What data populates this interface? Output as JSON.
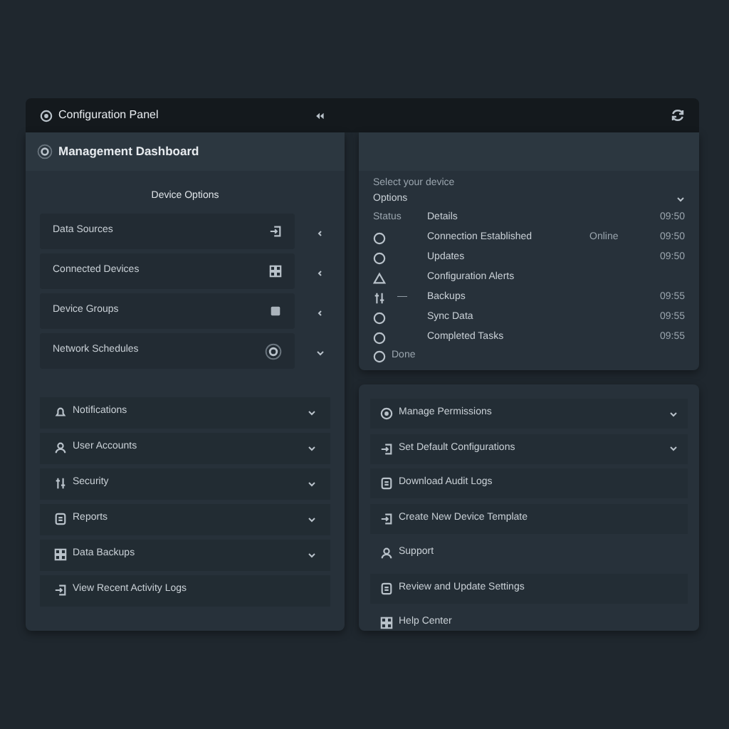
{
  "top_bar": {
    "title": "Configuration Panel"
  },
  "left_panel": {
    "title": "Management Dashboard",
    "subtitle": "Device Options",
    "settings": [
      {
        "label": "Data Sources",
        "expanded": false
      },
      {
        "label": "Connected Devices",
        "expanded": false
      },
      {
        "label": "Device Groups",
        "expanded": false
      },
      {
        "label": "Network Schedules",
        "expanded": true
      }
    ],
    "sections": [
      {
        "label": "Notifications",
        "kind": "collapsible"
      },
      {
        "label": "User Accounts",
        "kind": "collapsible"
      },
      {
        "label": "Security",
        "kind": "collapsible"
      },
      {
        "label": "Reports",
        "kind": "collapsible"
      },
      {
        "label": "Data Backups",
        "kind": "collapsible"
      },
      {
        "label": "View Recent Activity Logs",
        "kind": "link"
      }
    ]
  },
  "status_panel": {
    "caption": "Select your device",
    "filter": "Options",
    "columns": [
      "Status",
      "Details",
      "09:50"
    ],
    "rows": [
      {
        "name": "Connection Established",
        "note": "Online",
        "time": "09:50"
      },
      {
        "name": "Updates",
        "time": "09:50"
      },
      {
        "name": "Configuration Alerts"
      },
      {
        "marker": "—",
        "name": "Backups",
        "time": "09:55"
      },
      {
        "name": "Sync Data",
        "time": "09:55"
      },
      {
        "name": "Completed Tasks",
        "time": "09:55"
      }
    ],
    "footer": "Done"
  },
  "actions_panel": {
    "items": [
      {
        "label": "Manage Permissions",
        "kind": "collapsible"
      },
      {
        "label": "Set Default Configurations",
        "kind": "collapsible"
      },
      {
        "label": "Download Audit Logs",
        "kind": "link"
      },
      {
        "label": "Create New Device Template",
        "kind": "link"
      },
      {
        "label": "Support",
        "kind": "plain"
      },
      {
        "label": "Review and Update Settings",
        "kind": "link"
      },
      {
        "label": "Help Center",
        "kind": "plain"
      }
    ]
  }
}
